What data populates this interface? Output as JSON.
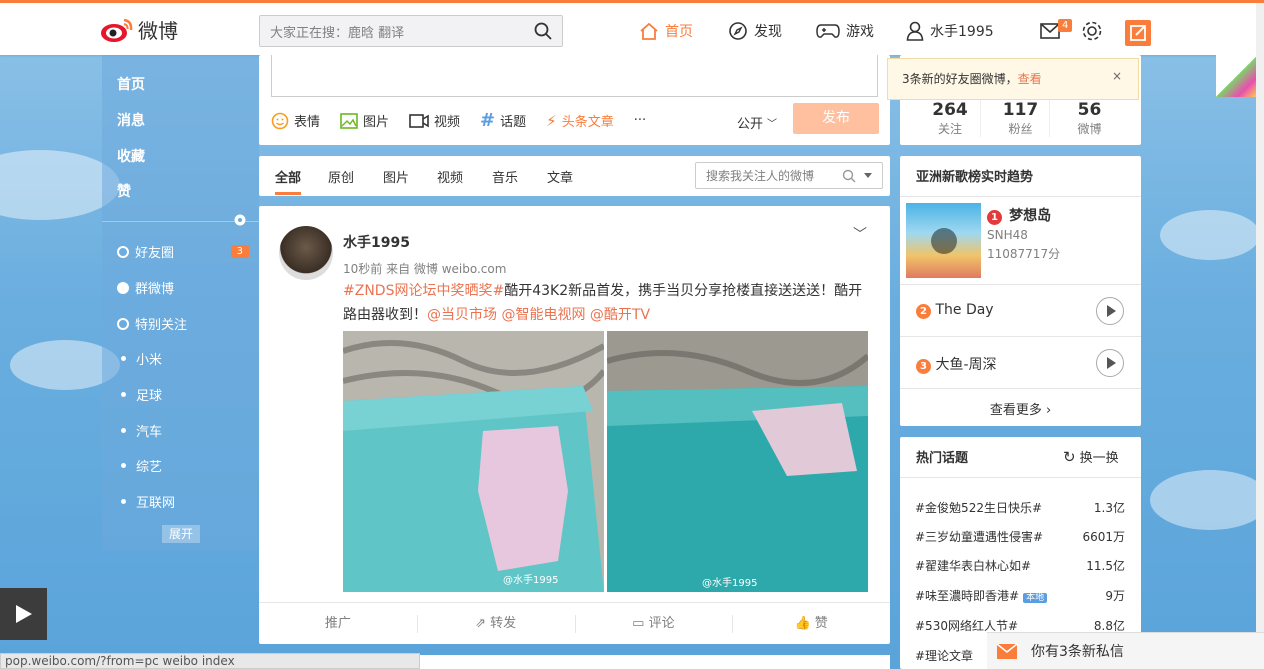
{
  "brand": {
    "name": "微博"
  },
  "search": {
    "placeholder": "大家正在搜：鹿晗 翻译"
  },
  "nav": {
    "home": "首页",
    "discover": "发现",
    "game": "游戏",
    "user": "水手1995",
    "mail_count": "4"
  },
  "leftnav": {
    "main": [
      "首页",
      "消息",
      "收藏",
      "赞"
    ],
    "groups": [
      {
        "label": "好友圈",
        "badge": "3"
      },
      {
        "label": "群微博"
      },
      {
        "label": "特别关注"
      }
    ],
    "subs": [
      "小米",
      "足球",
      "汽车",
      "综艺",
      "互联网"
    ],
    "expand": "展开"
  },
  "publisher": {
    "tools": [
      "表情",
      "图片",
      "视频",
      "话题",
      "头条文章",
      "···"
    ],
    "visibility": "公开",
    "send": "发布"
  },
  "feed_tabs": {
    "tabs": [
      "全部",
      "原创",
      "图片",
      "视频",
      "音乐",
      "文章"
    ],
    "search_placeholder": "搜索我关注人的微博"
  },
  "post": {
    "author": "水手1995",
    "meta": "10秒前 来自 微博 weibo.com",
    "hashtag": "#ZNDS网论坛中奖晒奖#",
    "text1": "酷开43K2新品首发，携手当贝分享抢楼直接送送送！酷开路由器收到！",
    "mentions": [
      "@当贝市场",
      "@智能电视网",
      "@酷开TV"
    ],
    "img_watermark": "@水手1995",
    "actions": [
      "推广",
      "转发",
      "评论",
      "赞"
    ]
  },
  "profile_stats": [
    {
      "num": "264",
      "label": "关注"
    },
    {
      "num": "117",
      "label": "粉丝"
    },
    {
      "num": "56",
      "label": "微博"
    }
  ],
  "notice": {
    "text": "3条新的好友圈微博，",
    "link": "查看",
    "close": "×"
  },
  "music": {
    "title": "亚洲新歌榜实时趋势",
    "items": [
      {
        "rank": "1",
        "title": "梦想岛",
        "artist": "SNH48",
        "score": "11087717分"
      },
      {
        "rank": "2",
        "title": "The Day"
      },
      {
        "rank": "3",
        "title": "大鱼-周深"
      }
    ],
    "more": "查看更多"
  },
  "topics": {
    "title": "热门话题",
    "refresh": "换一换",
    "items": [
      {
        "name": "#金俊勉522生日快乐#",
        "count": "1.3亿"
      },
      {
        "name": "#三岁幼童遭遇性侵害#",
        "count": "6601万"
      },
      {
        "name": "#翟建华表白林心如#",
        "count": "11.5亿"
      },
      {
        "name": "#味至濃時即香港#",
        "count": "9万",
        "tag": "本地"
      },
      {
        "name": "#530网络红人节#",
        "count": "8.8亿"
      },
      {
        "name": "#理论文章"
      }
    ]
  },
  "messages": {
    "text": "你有3条新私信"
  },
  "status_url": "pop.weibo.com/?from=pc weibo index",
  "colors": {
    "accent": "#fa7d3c",
    "link": "#eb7350",
    "sky": "#6aaedf"
  }
}
